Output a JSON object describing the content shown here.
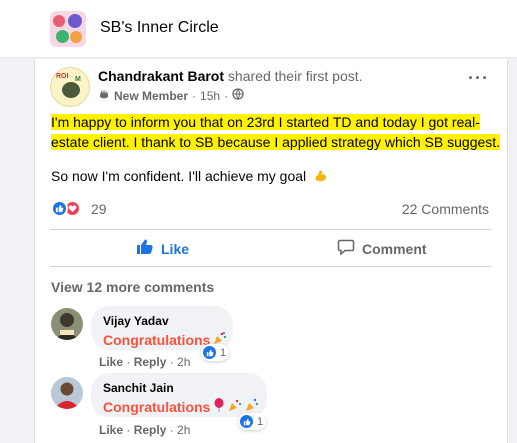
{
  "group": {
    "title": "SB's Inner Circle"
  },
  "post": {
    "author": "Chandrakant Barot",
    "action": "shared their first post.",
    "badge": "New Member",
    "time": "15h",
    "line1": "I'm happy to inform you that on 23rd I started TD and today I got real-estate client. I thank to SB because I applied strategy which SB suggest.",
    "line2": "So now I'm confident. I'll achieve my goal",
    "reactions_count": "29",
    "comments_count": "22 Comments",
    "like_label": "Like",
    "comment_label": "Comment",
    "view_more": "View 12 more comments"
  },
  "comments": [
    {
      "name": "Vijay Yadav",
      "text": "Congratulations",
      "like": "Like",
      "reply": "Reply",
      "time": "2h",
      "reactions": "1"
    },
    {
      "name": "Sanchit Jain",
      "text": "Congratulations",
      "like": "Like",
      "reply": "Reply",
      "time": "2h",
      "reactions": "1"
    }
  ],
  "colors": {
    "accent": "#1b74e4",
    "highlight": "#fff200",
    "congrats": "#f5533d"
  },
  "icons": [
    "more-icon",
    "globe-icon",
    "new-member-icon",
    "like-icon",
    "love-icon",
    "comment-icon",
    "flex-emoji-icon",
    "party-popper-icon",
    "balloon-icon"
  ]
}
